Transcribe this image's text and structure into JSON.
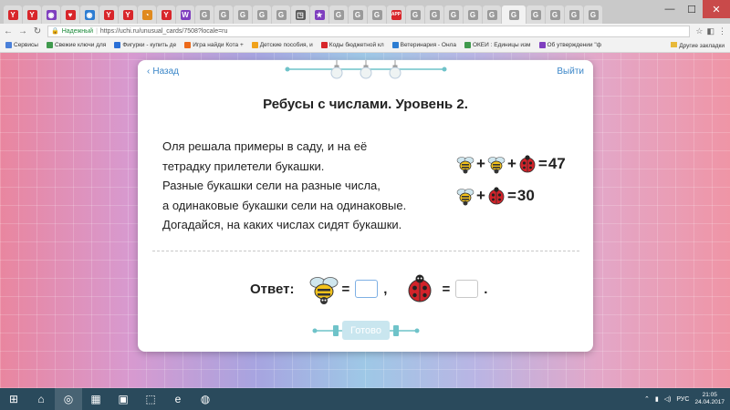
{
  "browser": {
    "tabs": [
      {
        "glyph": "Y",
        "color": "#d8262b"
      },
      {
        "glyph": "Y",
        "color": "#d8262b"
      },
      {
        "glyph": "◉",
        "color": "#7f3fbf"
      },
      {
        "glyph": "♥",
        "color": "#d8262b"
      },
      {
        "glyph": "◉",
        "color": "#2d7dd2"
      },
      {
        "glyph": "Y",
        "color": "#d8262b"
      },
      {
        "glyph": "Y",
        "color": "#d8262b"
      },
      {
        "glyph": "◔",
        "color": "#e08a1e"
      },
      {
        "glyph": "Y",
        "color": "#d8262b"
      },
      {
        "glyph": "W",
        "color": "#7f3fbf"
      },
      {
        "glyph": "G",
        "color": "#9a9a9a"
      },
      {
        "glyph": "G",
        "color": "#9a9a9a"
      },
      {
        "glyph": "G",
        "color": "#9a9a9a"
      },
      {
        "glyph": "G",
        "color": "#9a9a9a"
      },
      {
        "glyph": "G",
        "color": "#9a9a9a"
      },
      {
        "glyph": "◳",
        "color": "#5a5a5a"
      },
      {
        "glyph": "★",
        "color": "#7f3fbf"
      },
      {
        "glyph": "G",
        "color": "#9a9a9a"
      },
      {
        "glyph": "G",
        "color": "#9a9a9a"
      },
      {
        "glyph": "G",
        "color": "#9a9a9a"
      },
      {
        "glyph": "APP",
        "color": "#d8262b"
      },
      {
        "glyph": "G",
        "color": "#9a9a9a"
      },
      {
        "glyph": "G",
        "color": "#9a9a9a"
      },
      {
        "glyph": "G",
        "color": "#9a9a9a"
      },
      {
        "glyph": "G",
        "color": "#9a9a9a"
      },
      {
        "glyph": "G",
        "color": "#9a9a9a"
      },
      {
        "glyph": "G",
        "color": "#9a9a9a"
      },
      {
        "glyph": "G",
        "color": "#9a9a9a"
      },
      {
        "glyph": "G",
        "color": "#9a9a9a"
      },
      {
        "glyph": "G",
        "color": "#9a9a9a"
      },
      {
        "glyph": "G",
        "color": "#9a9a9a"
      }
    ],
    "win_controls": {
      "minimize": "—",
      "maximize": "☐",
      "close": "✕"
    },
    "address": {
      "secure_label": "Надежный",
      "url": "https://uchi.ru/unusual_cards/7508?locale=ru"
    },
    "bookmarks": [
      {
        "label": "Сервисы",
        "color": "#4a80d9"
      },
      {
        "label": "Свежие ключи для",
        "color": "#3f9a4d"
      },
      {
        "label": "Фигурки - купить де",
        "color": "#2a6fd6"
      },
      {
        "label": "Игра найди Кота +",
        "color": "#ec6a1b"
      },
      {
        "label": "Детские пособия, и",
        "color": "#f0a21b"
      },
      {
        "label": "Коды бюджетной кл",
        "color": "#d8262b"
      },
      {
        "label": "Ветеринария - Онла",
        "color": "#2d7dd2"
      },
      {
        "label": "ОКЕИ : Единицы изм",
        "color": "#3f9a4d"
      },
      {
        "label": "Об утверждении \"ф",
        "color": "#7f3fbf"
      }
    ],
    "other_bookmarks": "Другие закладки"
  },
  "card": {
    "back_label": "Назад",
    "logout_label": "Выйти",
    "title": "Ребусы с числами. Уровень 2.",
    "task_lines": [
      "Оля решала примеры в саду, и на её",
      "тетрадку прилетели букашки.",
      "Разные букашки сели на разные числа,",
      "а одинаковые букашки сели на одинаковые.",
      "Догадайся, на каких числах сидят букашки."
    ],
    "equation1": {
      "ops": [
        "+",
        "+",
        "="
      ],
      "result": "47"
    },
    "equation2": {
      "ops": [
        "+",
        "="
      ],
      "result": "30"
    },
    "answer": {
      "label": "Ответ:",
      "eq1": "=",
      "sep": ",",
      "eq2": "=",
      "end": "."
    },
    "ready_label": "Готово"
  },
  "taskbar": {
    "apps": [
      "⊞",
      "⌂",
      "◎",
      "▦",
      "▣",
      "⬚",
      "e",
      "◍"
    ],
    "lang": "РУС",
    "time": "21:05",
    "date": "24.04.2017"
  },
  "colors": {
    "link": "#3a86c8",
    "input_border": "#7eb0e4",
    "ready_button": "#c9e6ef"
  }
}
